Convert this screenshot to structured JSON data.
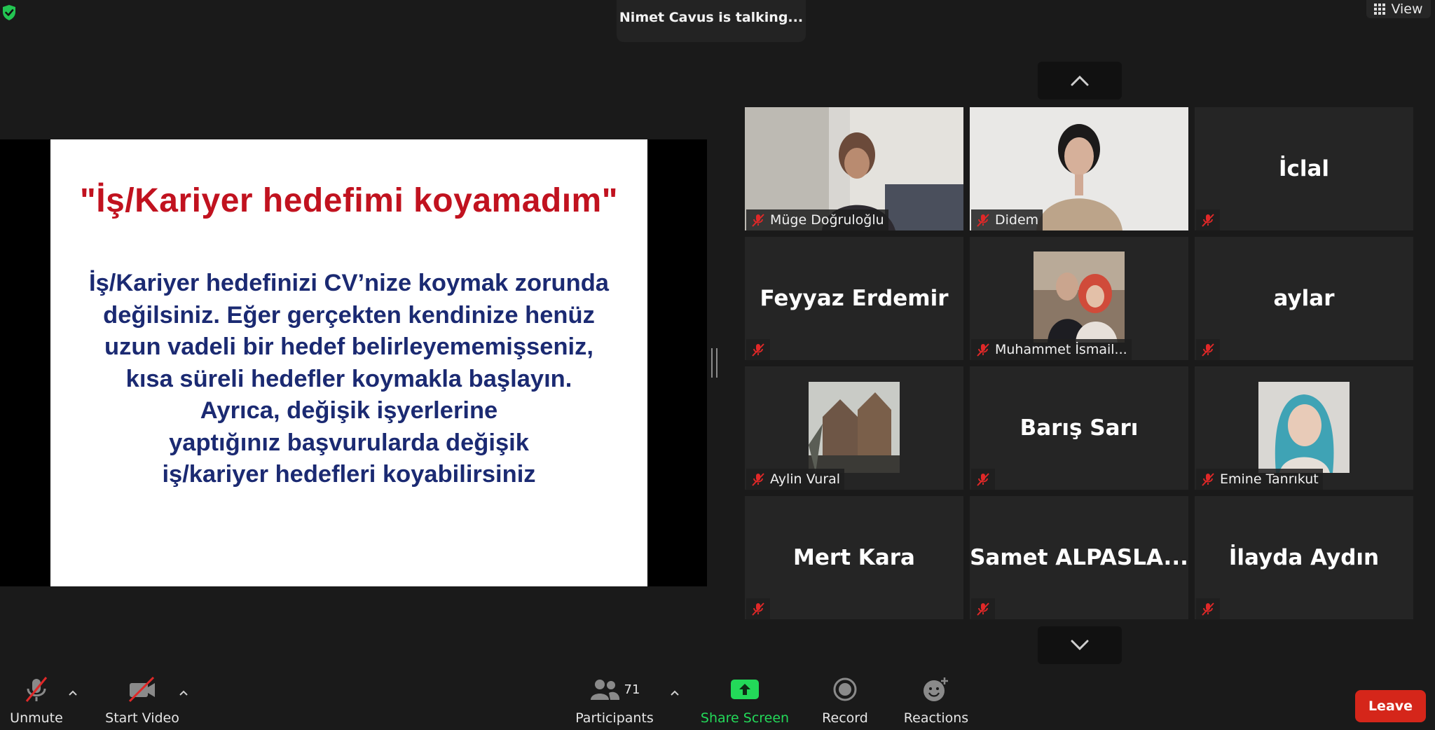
{
  "status": {
    "talking_banner": "Nimet Cavus is talking...",
    "view_label": "View"
  },
  "slide": {
    "title": "\"İş/Kariyer hedefimi koyamadım\"",
    "body_lines": [
      "İş/Kariyer hedefinizi CV’nize koymak zorunda",
      "değilsiniz. Eğer gerçekten kendinize henüz",
      "uzun vadeli bir hedef belirleyememişseniz,",
      "kısa süreli hedefler koymakla başlayın.",
      "Ayrıca, değişik işyerlerine",
      "yaptığınız başvurularda değişik",
      "iş/kariyer hedefleri koyabilirsiniz"
    ]
  },
  "participants_grid": [
    {
      "name": "Müge Doğruloğlu",
      "display": "",
      "kind": "video"
    },
    {
      "name": "Didem",
      "display": "",
      "kind": "video"
    },
    {
      "name": "",
      "display": "İclal",
      "kind": "name"
    },
    {
      "name": "",
      "display": "Feyyaz Erdemir",
      "kind": "name"
    },
    {
      "name": "Muhammet İsmail...",
      "display": "",
      "kind": "avatar"
    },
    {
      "name": "",
      "display": "aylar",
      "kind": "name"
    },
    {
      "name": "Aylin Vural",
      "display": "",
      "kind": "avatar"
    },
    {
      "name": "",
      "display": "Barış Sarı",
      "kind": "name"
    },
    {
      "name": "Emine Tanrıkut",
      "display": "",
      "kind": "avatar"
    },
    {
      "name": "",
      "display": "Mert Kara",
      "kind": "name"
    },
    {
      "name": "",
      "display": "Samet  ALPASLA...",
      "kind": "name"
    },
    {
      "name": "",
      "display": "İlayda Aydın",
      "kind": "name"
    }
  ],
  "toolbar": {
    "unmute_label": "Unmute",
    "start_video_label": "Start Video",
    "participants_label": "Participants",
    "participants_count": "71",
    "share_screen_label": "Share Screen",
    "record_label": "Record",
    "reactions_label": "Reactions",
    "leave_label": "Leave"
  },
  "colors": {
    "background": "#1a1a1a",
    "tile": "#252525",
    "share_green": "#23d959",
    "leave_red": "#d5261a",
    "muted_red": "#e02828",
    "slide_title": "#c1121f",
    "slide_body": "#1b2a72"
  }
}
